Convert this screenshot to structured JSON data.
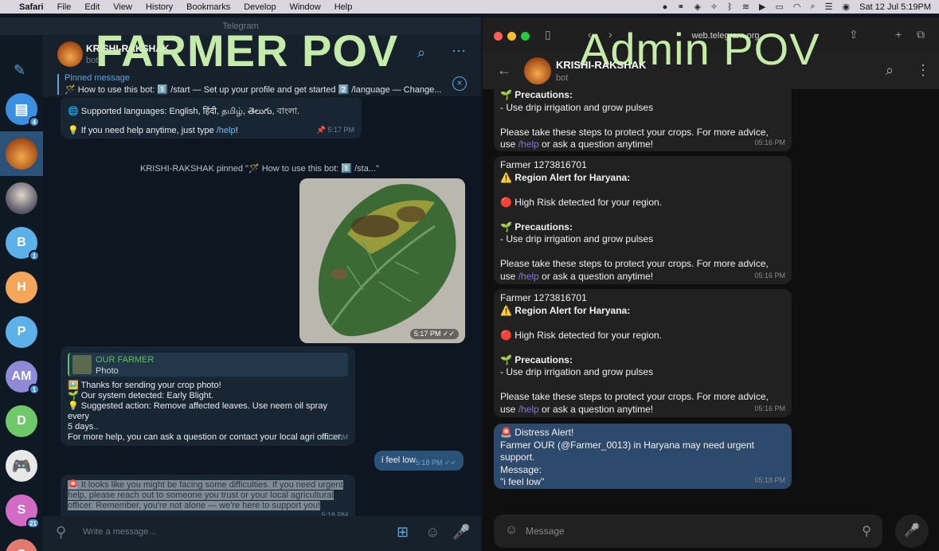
{
  "menubar": {
    "apple": "",
    "app": "Safari",
    "items": [
      "File",
      "Edit",
      "View",
      "History",
      "Bookmarks",
      "Develop",
      "Window",
      "Help"
    ],
    "datetime": "Sat 12 Jul  5:19PM"
  },
  "overlay": {
    "left_label": "FARMER POV",
    "right_label": "Admin POV"
  },
  "left": {
    "window_title": "Telegram",
    "bot_name": "KRISHI-RAKSHAK",
    "bot_sub": "bot",
    "pinned_label": "Pinned message",
    "pinned_text": "🪄 How to use this bot: 1️⃣ /start — Set up your profile and get started 2️⃣ /language — Change...",
    "chat_list": [
      {
        "label": "",
        "badge": "4"
      },
      {
        "label": "",
        "badge": ""
      },
      {
        "label": "",
        "badge": ""
      },
      {
        "label": "B",
        "badge": "1"
      },
      {
        "label": "H",
        "badge": ""
      },
      {
        "label": "P",
        "badge": ""
      },
      {
        "label": "AM",
        "badge": "1"
      },
      {
        "label": "D",
        "badge": ""
      },
      {
        "label": "",
        "badge": ""
      },
      {
        "label": "S",
        "badge": "21"
      },
      {
        "label": "G",
        "badge": ""
      }
    ],
    "msg1_line1": "🌐 Supported languages: English, हिंदी, தமிழ், తెలుగు, বাংলা.",
    "msg1_line2_pre": "💡 If you need help anytime, just type ",
    "msg1_link": "/help",
    "msg1_line2_post": "!",
    "msg1_time": "5:17 PM",
    "system_msg": "KRISHI-RAKSHAK pinned \"🪄 How to use this bot: 1️⃣ /sta...\"",
    "photo_time": "5:17 PM",
    "reply_name": "OUR FARMER",
    "reply_sub": "Photo",
    "msg2_lines": [
      "🖼️ Thanks for sending your crop photo!",
      "🌱 Our system detected: Early Blight.",
      "💡 Suggested action: Remove affected leaves. Use neem oil spray every",
      "5 days..",
      "For more help, you can ask a question or contact your local agri officer."
    ],
    "msg2_time": "5:18 PM",
    "out_msg": "i feel low",
    "out_time": "5:18 PM",
    "msg3_lines": [
      "🚨 It looks like you might be facing some difficulties. If you need urgent",
      "help, please reach out to someone you trust or your local agricultural",
      "officer. Remember, you're not alone — we're here to support you!"
    ],
    "msg3_time": "5:18 PM",
    "input_placeholder": "Write a message..."
  },
  "right": {
    "url": "web.telegram.org",
    "bot_name": "KRISHI-RAKSHAK",
    "bot_sub": "bot",
    "alert_top": {
      "lines": [
        "🌱 Precautions:",
        "- Use drip irrigation and grow pulses",
        "",
        "Please take these steps to protect your crops. For more advice,"
      ],
      "last_pre": "use ",
      "last_link": "/help",
      "last_post": " or ask a question anytime!",
      "time": "05:16 PM"
    },
    "alerts": [
      {
        "farmer": "Farmer 1273816701",
        "title": "⚠️ Region Alert for Haryana:",
        "risk": "🔴 High Risk detected for your region.",
        "prec_title": "🌱 Precautions:",
        "prec": "- Use drip irrigation and grow pulses",
        "advice": "Please take these steps to protect your crops. For more advice,",
        "last_pre": "use ",
        "last_link": "/help",
        "last_post": " or ask a question anytime!",
        "time": "05:16 PM"
      },
      {
        "farmer": "Farmer 1273816701",
        "title": "⚠️ Region Alert for Haryana:",
        "risk": "🔴 High Risk detected for your region.",
        "prec_title": "🌱 Precautions:",
        "prec": "- Use drip irrigation and grow pulses",
        "advice": "Please take these steps to protect your crops. For more advice,",
        "last_pre": "use ",
        "last_link": "/help",
        "last_post": " or ask a question anytime!",
        "time": "05:16 PM"
      }
    ],
    "distress": {
      "lines": [
        "🚨 Distress Alert!",
        "Farmer OUR (@Farmer_0013) in Haryana may need urgent",
        "support.",
        "Message:",
        "\"i feel low\""
      ],
      "time": "05:18 PM"
    },
    "input_placeholder": "Message"
  }
}
